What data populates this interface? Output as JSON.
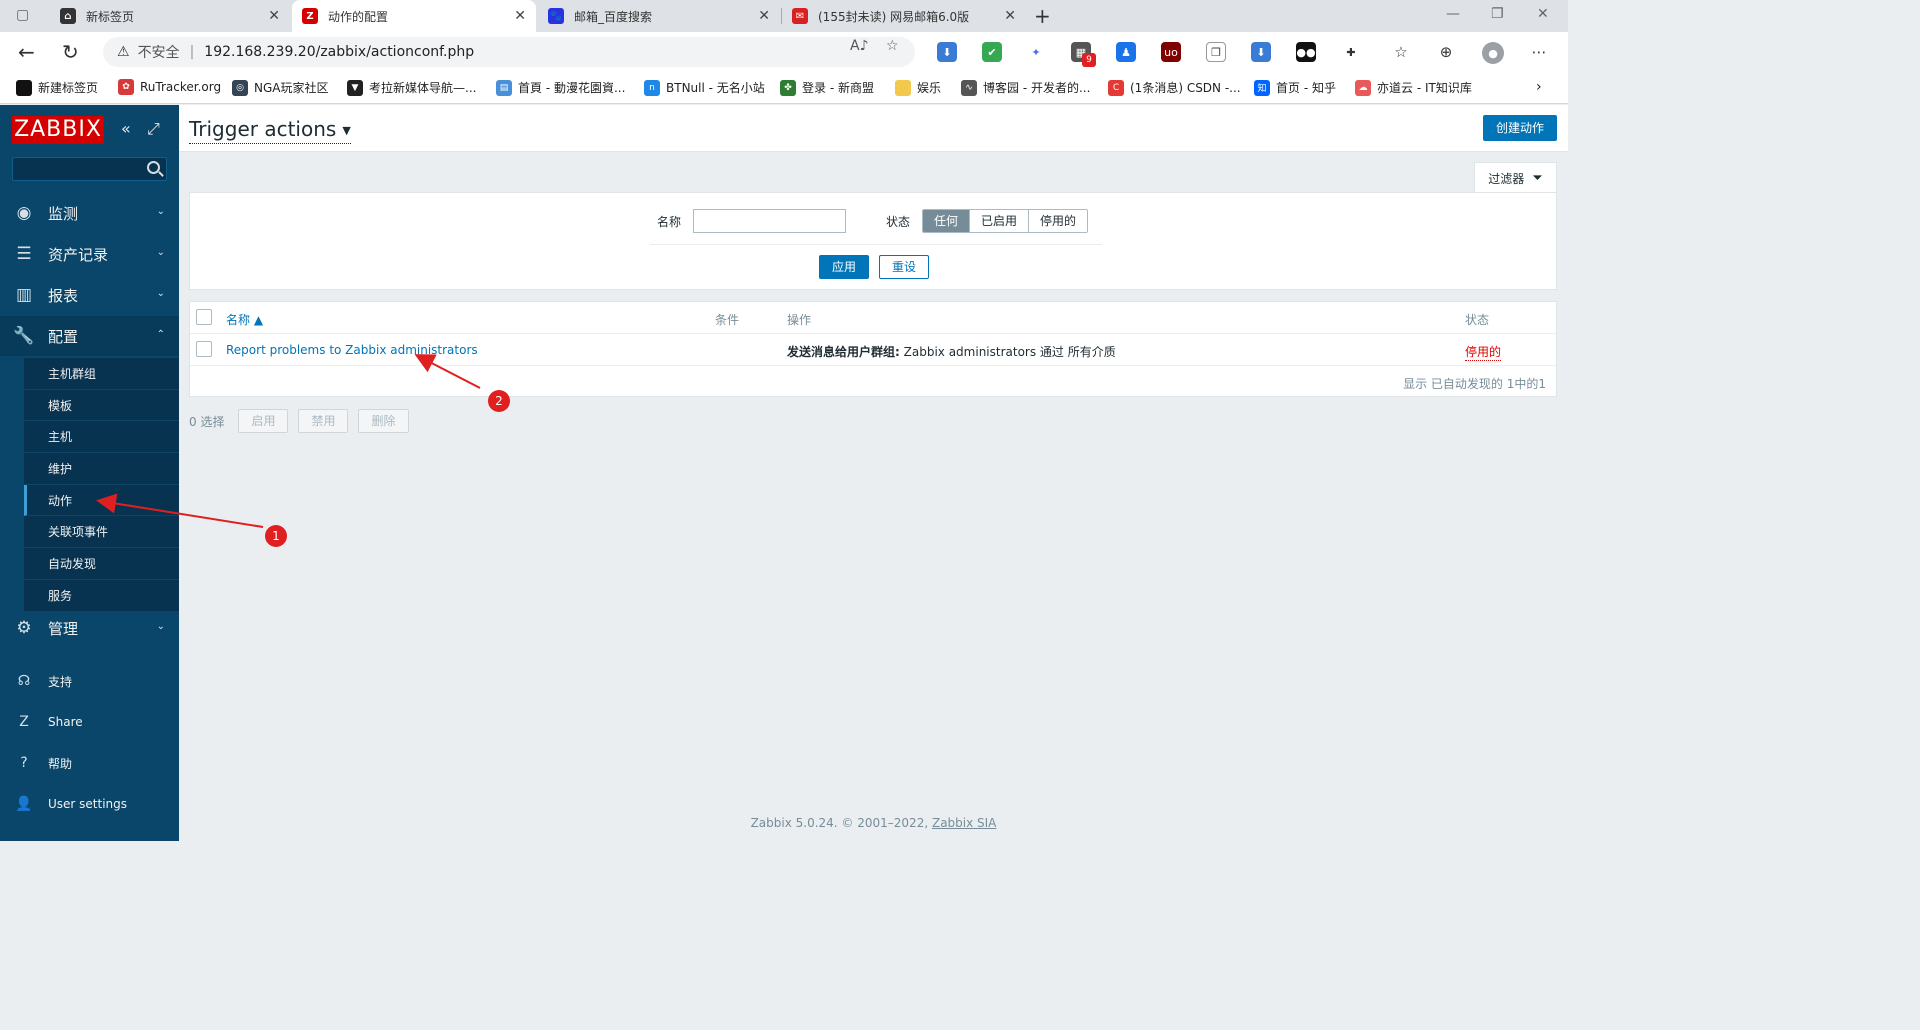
{
  "browser": {
    "tabs": [
      {
        "title": "新标签页"
      },
      {
        "title": "动作的配置"
      },
      {
        "title": "邮箱_百度搜索"
      },
      {
        "title": "(155封未读) 网易邮箱6.0版"
      }
    ],
    "address": {
      "security_label": "不安全",
      "url": "192.168.239.20/zabbix/actionconf.php"
    },
    "ext_badge": "9",
    "bookmarks": [
      {
        "label": "新建标签页",
        "color": "#111111"
      },
      {
        "label": "RuTracker.org",
        "color": "#d63a3a"
      },
      {
        "label": "NGA玩家社区",
        "color": "#334455"
      },
      {
        "label": "考拉新媒体导航—...",
        "color": "#222222"
      },
      {
        "label": "首頁 - 動漫花園資...",
        "color": "#4a90d9"
      },
      {
        "label": "BTNull - 无名小站",
        "color": "#1e88e5"
      },
      {
        "label": "登录 - 新商盟",
        "color": "#2e7d32"
      },
      {
        "label": "娱乐",
        "color": "#f2c94c"
      },
      {
        "label": "博客园 - 开发者的...",
        "color": "#555555"
      },
      {
        "label": "(1条消息) CSDN -...",
        "color": "#e53935"
      },
      {
        "label": "首页 - 知乎",
        "color": "#0066ff"
      },
      {
        "label": "亦道云 - IT知识库",
        "color": "#e85a5a"
      }
    ]
  },
  "sidebar": {
    "logo": "ZABBIX",
    "menu": [
      {
        "label": "监测",
        "icon": "eye-icon"
      },
      {
        "label": "资产记录",
        "icon": "list-icon"
      },
      {
        "label": "报表",
        "icon": "chart-icon"
      },
      {
        "label": "配置",
        "icon": "wrench-icon"
      },
      {
        "label": "管理",
        "icon": "gear-icon"
      }
    ],
    "submenu": [
      {
        "label": "主机群组"
      },
      {
        "label": "模板"
      },
      {
        "label": "主机"
      },
      {
        "label": "维护"
      },
      {
        "label": "动作"
      },
      {
        "label": "关联项事件"
      },
      {
        "label": "自动发现"
      },
      {
        "label": "服务"
      }
    ],
    "bottom": [
      {
        "label": "支持"
      },
      {
        "label": "Share"
      },
      {
        "label": "帮助"
      },
      {
        "label": "User settings"
      }
    ]
  },
  "header": {
    "title": "Trigger actions",
    "create_button": "创建动作"
  },
  "filter": {
    "tab_label": "过滤器",
    "name_label": "名称",
    "name_value": "",
    "status_label": "状态",
    "status_options": [
      "任何",
      "已启用",
      "停用的"
    ],
    "status_selected": "任何",
    "apply": "应用",
    "reset": "重设"
  },
  "table": {
    "columns": {
      "name": "名称",
      "conditions": "条件",
      "operations": "操作",
      "status": "状态"
    },
    "rows": [
      {
        "name": "Report problems to Zabbix administrators",
        "conditions": "",
        "operation_bold": "发送消息给用户群组:",
        "operation_rest": "Zabbix administrators 通过 所有介质",
        "status": "停用的"
      }
    ],
    "footer": "显示 已自动发现的 1中的1"
  },
  "actions": {
    "selected": "0 选择",
    "enable": "启用",
    "disable": "禁用",
    "delete": "删除"
  },
  "footer": {
    "text": "Zabbix 5.0.24. © 2001–2022,",
    "company": "Zabbix SIA"
  },
  "annotations": [
    "1",
    "2"
  ],
  "colors": {
    "sidebar": "#0a466a",
    "accent": "#0275b8",
    "disabled_status": "#dc0000",
    "annotation": "#e02020",
    "logo": "#d40000"
  }
}
